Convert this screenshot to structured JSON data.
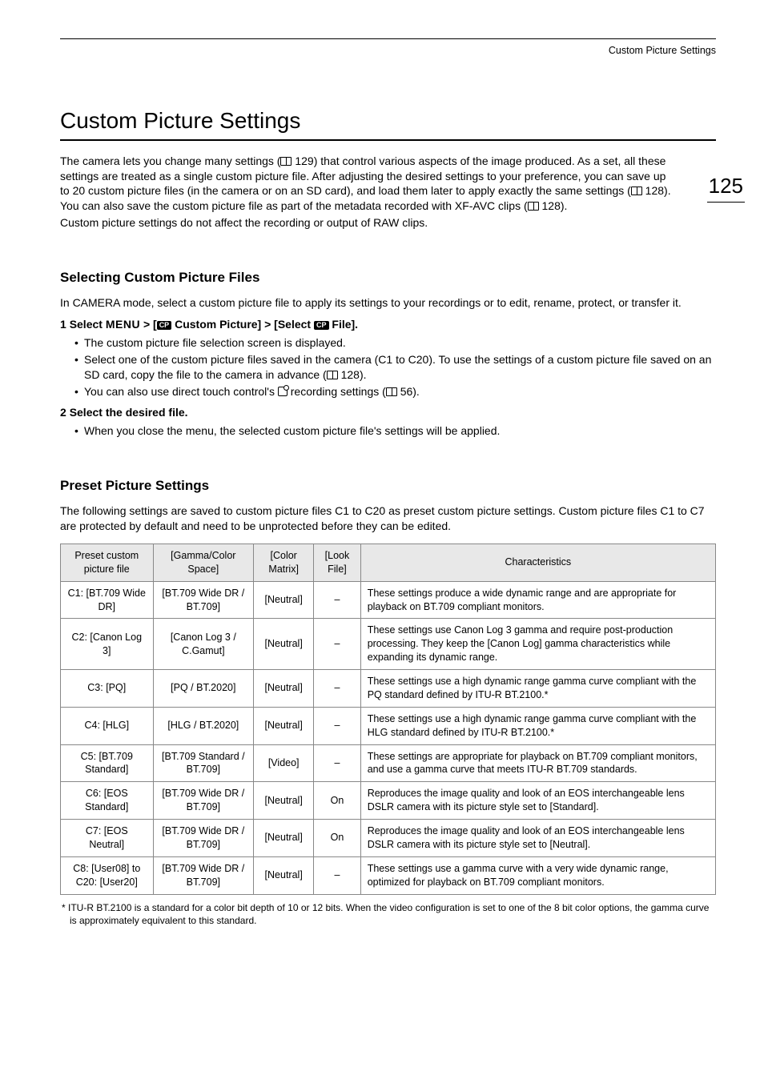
{
  "running_head": "Custom Picture Settings",
  "page_number": "125",
  "h1": "Custom Picture Settings",
  "intro": {
    "p1a": "The camera lets you change many settings (",
    "p1b": " 129) that control various aspects of the image produced. As a set, all these settings are treated as a single custom picture file. After adjusting the desired settings to your preference, you can save up to 20 custom picture files (in the camera or on an SD card), and load them later to apply exactly the same settings (",
    "p1c": " 128). You can also save the custom picture file as part of the metadata recorded with XF-AVC clips (",
    "p1d": " 128).",
    "p2": "Custom picture settings do not affect the recording or output of RAW clips."
  },
  "section1": {
    "heading": "Selecting Custom Picture Files",
    "intro": "In CAMERA mode, select a custom picture file to apply its settings to your recordings or to edit, rename, protect, or transfer it.",
    "step1": {
      "num": "1",
      "lead": "Select ",
      "menu": "MENU",
      "sep": " > [",
      "cp1": "CP",
      "mid": " Custom Picture] > [Select ",
      "cp2": "CP",
      "tail": " File].",
      "b1": "The custom picture file selection screen is displayed.",
      "b2a": "Select one of the custom picture files saved in the camera (C1 to C20). To use the settings of a custom picture file saved on an SD card, copy the file to the camera in advance (",
      "b2b": " 128).",
      "b3a": "You can also use direct touch control's ",
      "b3b": " recording settings (",
      "b3c": " 56)."
    },
    "step2": {
      "num": "2",
      "head": "Select the desired file.",
      "b1": "When you close the menu, the selected custom picture file's settings will be applied."
    }
  },
  "section2": {
    "heading": "Preset Picture Settings",
    "intro": "The following settings are saved to custom picture files C1 to C20 as preset custom picture settings. Custom picture files C1 to C7 are protected by default and need to be unprotected before they can be edited.",
    "headers": {
      "c1": "Preset custom picture file",
      "c2": "[Gamma/Color Space]",
      "c3": "[Color Matrix]",
      "c4": "[Look File]",
      "c5": "Characteristics"
    },
    "rows": [
      {
        "file": "C1: [BT.709 Wide DR]",
        "gcs": "[BT.709 Wide DR / BT.709]",
        "cm": "[Neutral]",
        "lf": "–",
        "char": "These settings produce a wide dynamic range and are appropriate for playback on BT.709 compliant monitors."
      },
      {
        "file": "C2: [Canon Log 3]",
        "gcs": "[Canon Log 3 / C.Gamut]",
        "cm": "[Neutral]",
        "lf": "–",
        "char": "These settings use Canon Log 3 gamma and require post-production processing. They keep the [Canon Log] gamma characteristics while expanding its dynamic range."
      },
      {
        "file": "C3: [PQ]",
        "gcs": "[PQ / BT.2020]",
        "cm": "[Neutral]",
        "lf": "–",
        "char": "These settings use a high dynamic range gamma curve compliant with the PQ standard defined by ITU-R BT.2100.*"
      },
      {
        "file": "C4: [HLG]",
        "gcs": "[HLG / BT.2020]",
        "cm": "[Neutral]",
        "lf": "–",
        "char": "These settings use a high dynamic range gamma curve compliant with the HLG standard defined by ITU-R BT.2100.*"
      },
      {
        "file": "C5: [BT.709 Standard]",
        "gcs": "[BT.709 Standard / BT.709]",
        "cm": "[Video]",
        "lf": "–",
        "char": "These settings are appropriate for playback on BT.709 compliant monitors, and use a gamma curve that meets ITU-R BT.709 standards."
      },
      {
        "file": "C6: [EOS Standard]",
        "gcs": "[BT.709 Wide DR / BT.709]",
        "cm": "[Neutral]",
        "lf": "On",
        "char": "Reproduces the image quality and look of an EOS interchangeable lens DSLR camera with its picture style set to [Standard]."
      },
      {
        "file": "C7: [EOS Neutral]",
        "gcs": "[BT.709 Wide DR / BT.709]",
        "cm": "[Neutral]",
        "lf": "On",
        "char": "Reproduces the image quality and look of an EOS interchangeable lens DSLR camera with its picture style set to [Neutral]."
      },
      {
        "file": "C8: [User08] to C20: [User20]",
        "gcs": "[BT.709 Wide DR / BT.709]",
        "cm": "[Neutral]",
        "lf": "–",
        "char": "These settings use a gamma curve with a very wide dynamic range, optimized for playback on BT.709 compliant monitors."
      }
    ],
    "footnote": "* ITU-R BT.2100 is a standard for a color bit depth of 10 or 12 bits. When the video configuration is set to one of the 8 bit color options, the gamma curve is approximately equivalent to this standard."
  }
}
